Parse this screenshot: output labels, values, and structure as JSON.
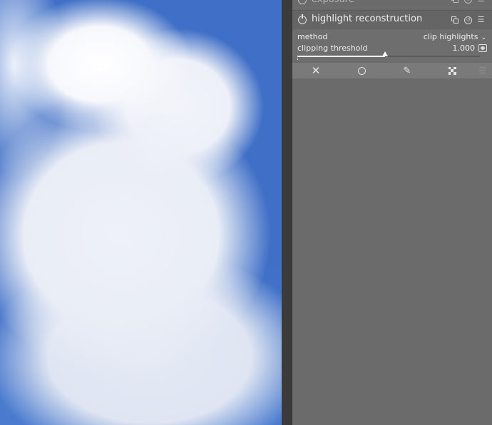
{
  "panel": {
    "exposure_module": {
      "title": "exposure"
    },
    "highlight_module": {
      "title": "highlight reconstruction",
      "method_label": "method",
      "method_value": "clip highlights",
      "threshold_label": "clipping threshold",
      "threshold_value": "1.000",
      "threshold_slider_level": 0.48
    },
    "header_icons": {
      "multi_instance": "multi-instance-icon",
      "reset": "reset-icon",
      "presets": "presets-menu-icon"
    },
    "blend_toolbar": {
      "icons": [
        "blend-off-icon",
        "uniform-blend-icon",
        "drawn-mask-icon",
        "parametric-mask-icon",
        "blend-menu-icon"
      ]
    }
  },
  "colors": {
    "sky": "#3f6fc6",
    "cloud": "#eef1f8",
    "panel_bg": "#6b6b6b",
    "toolbar_bg": "#7a7a7a"
  }
}
